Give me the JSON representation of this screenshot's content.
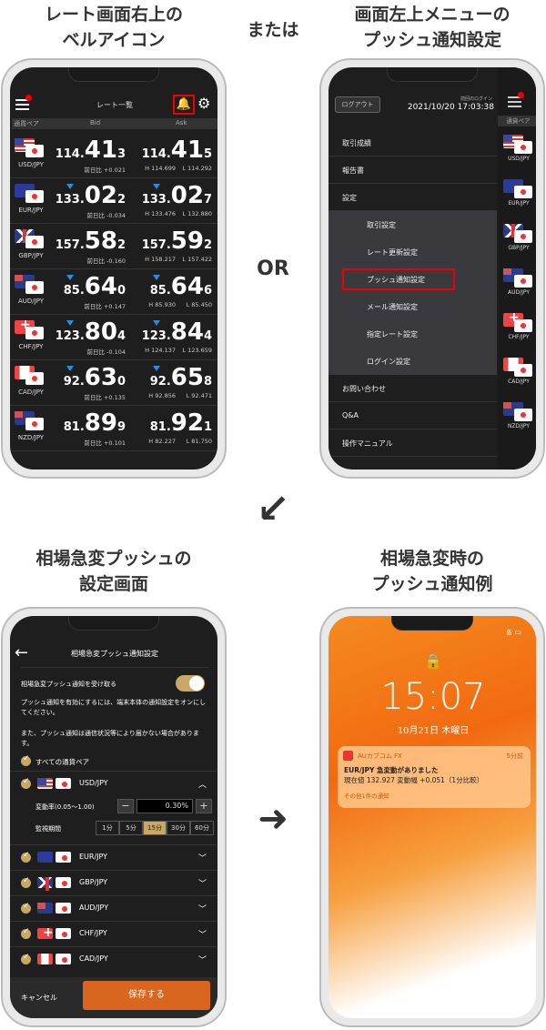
{
  "headings": {
    "top_left": [
      "レート画面右上の",
      "ベルアイコン"
    ],
    "top_mid": "または",
    "top_right": [
      "画面左上メニューの",
      "プッシュ通知設定"
    ],
    "or": "OR",
    "bottom_left": [
      "相場急変プッシュの",
      "設定画面"
    ],
    "bottom_right": [
      "相場急変時の",
      "プッシュ通知例"
    ],
    "arrow_down": "↙",
    "arrow_right": "➜"
  },
  "rates": {
    "title": "レート一覧",
    "col_pair": "通貨ペア",
    "col_bid": "Bid",
    "col_ask": "Ask",
    "change_prefix": "前日比",
    "rows": [
      {
        "pair": "USD/JPY",
        "flag": "us",
        "down": false,
        "bid": [
          "114.",
          "41",
          "3"
        ],
        "ask": [
          "114.",
          "41",
          "5"
        ],
        "change": "前日比 +0.021",
        "high": "H 114.699",
        "low": "L 114.292"
      },
      {
        "pair": "EUR/JPY",
        "flag": "eu",
        "down": true,
        "bid": [
          "133.",
          "02",
          "2"
        ],
        "ask": [
          "133.",
          "02",
          "7"
        ],
        "change": "前日比 -0.034",
        "high": "H 133.476",
        "low": "L 132.880"
      },
      {
        "pair": "GBP/JPY",
        "flag": "gb",
        "down": false,
        "bid": [
          "157.",
          "58",
          "2"
        ],
        "ask": [
          "157.",
          "59",
          "2"
        ],
        "change": "前日比 -0.160",
        "high": "H 158.217",
        "low": "L 157.422"
      },
      {
        "pair": "AUD/JPY",
        "flag": "au",
        "down": true,
        "bid": [
          "85.",
          "64",
          "0"
        ],
        "ask": [
          "85.",
          "64",
          "6"
        ],
        "change": "前日比 +0.147",
        "high": "H 85.930",
        "low": "L 85.450"
      },
      {
        "pair": "CHF/JPY",
        "flag": "ch",
        "down": true,
        "bid": [
          "123.",
          "80",
          "4"
        ],
        "ask": [
          "123.",
          "84",
          "4"
        ],
        "change": "前日比 -0.104",
        "high": "H 124.137",
        "low": "L 123.659"
      },
      {
        "pair": "CAD/JPY",
        "flag": "ca",
        "down": true,
        "bid": [
          "92.",
          "63",
          "0"
        ],
        "ask": [
          "92.",
          "65",
          "8"
        ],
        "change": "前日比 +0.135",
        "high": "H 92.856",
        "low": "L 92.471"
      },
      {
        "pair": "NZD/JPY",
        "flag": "nz",
        "down": false,
        "bid": [
          "81.",
          "89",
          "9"
        ],
        "ask": [
          "81.",
          "92",
          "1"
        ],
        "change": "前日比 +0.101",
        "high": "H 82.227",
        "low": "L 81.750"
      }
    ]
  },
  "menu": {
    "logout": "ログアウト",
    "last_login_label": "前回のログイン",
    "last_login": "2021/10/20 17:03:38",
    "items": [
      "取引成績",
      "報告書",
      "設定"
    ],
    "sub_items": [
      "取引設定",
      "レート更新設定",
      "プッシュ通知設定",
      "メール通知設定",
      "指定レート設定",
      "ログイン設定"
    ],
    "after_items": [
      "お問い合わせ",
      "Q&A",
      "操作マニュアル"
    ],
    "side_header": "通貨ペア",
    "side_pairs": [
      {
        "pair": "USD/JPY",
        "flag": "us"
      },
      {
        "pair": "EUR/JPY",
        "flag": "eu"
      },
      {
        "pair": "GBP/JPY",
        "flag": "gb"
      },
      {
        "pair": "AUD/JPY",
        "flag": "au"
      },
      {
        "pair": "CHF/JPY",
        "flag": "ch"
      },
      {
        "pair": "CAD/JPY",
        "flag": "ca"
      },
      {
        "pair": "NZD/JPY",
        "flag": "nz"
      }
    ]
  },
  "settings": {
    "title": "相場急変プッシュ通知設定",
    "receive_label": "相場急変プッシュ通知を受け取る",
    "receive_on": true,
    "note1": "プッシュ通知を有効にするには、端末本体の通知設定をオンにしてください。",
    "note2": "また、プッシュ通知は通信状況等により届かない場合があります。",
    "all_pairs": "すべての通貨ペア",
    "rate_label": "変動率(0.05〜1.00)",
    "rate_value": "0.30%",
    "minus": "−",
    "plus": "+",
    "period_label": "監視期間",
    "periods": [
      "1分",
      "5分",
      "15分",
      "30分",
      "60分"
    ],
    "selected_period": "15分",
    "pairs": [
      {
        "pair": "USD/JPY",
        "flag": "us",
        "expanded": true
      },
      {
        "pair": "EUR/JPY",
        "flag": "eu"
      },
      {
        "pair": "GBP/JPY",
        "flag": "gb"
      },
      {
        "pair": "AUD/JPY",
        "flag": "au"
      },
      {
        "pair": "CHF/JPY",
        "flag": "ch"
      },
      {
        "pair": "CAD/JPY",
        "flag": "ca"
      }
    ],
    "cancel": "キャンセル",
    "save": "保存する"
  },
  "lock": {
    "time": "15:07",
    "date": "10月21日 木曜日",
    "notif_app": "AUカブコム FX",
    "notif_time": "5分前",
    "notif_title": "EUR/JPY 急変動がありました",
    "notif_body": "現在値 132.927 変動幅 +0.051（1分比較）",
    "notif_more": "その他1件の通知"
  },
  "colors": {
    "accent_gold": "#c9a866",
    "save_orange": "#d9651f",
    "highlight_red": "#e00000",
    "down_blue": "#2a8ee0"
  }
}
